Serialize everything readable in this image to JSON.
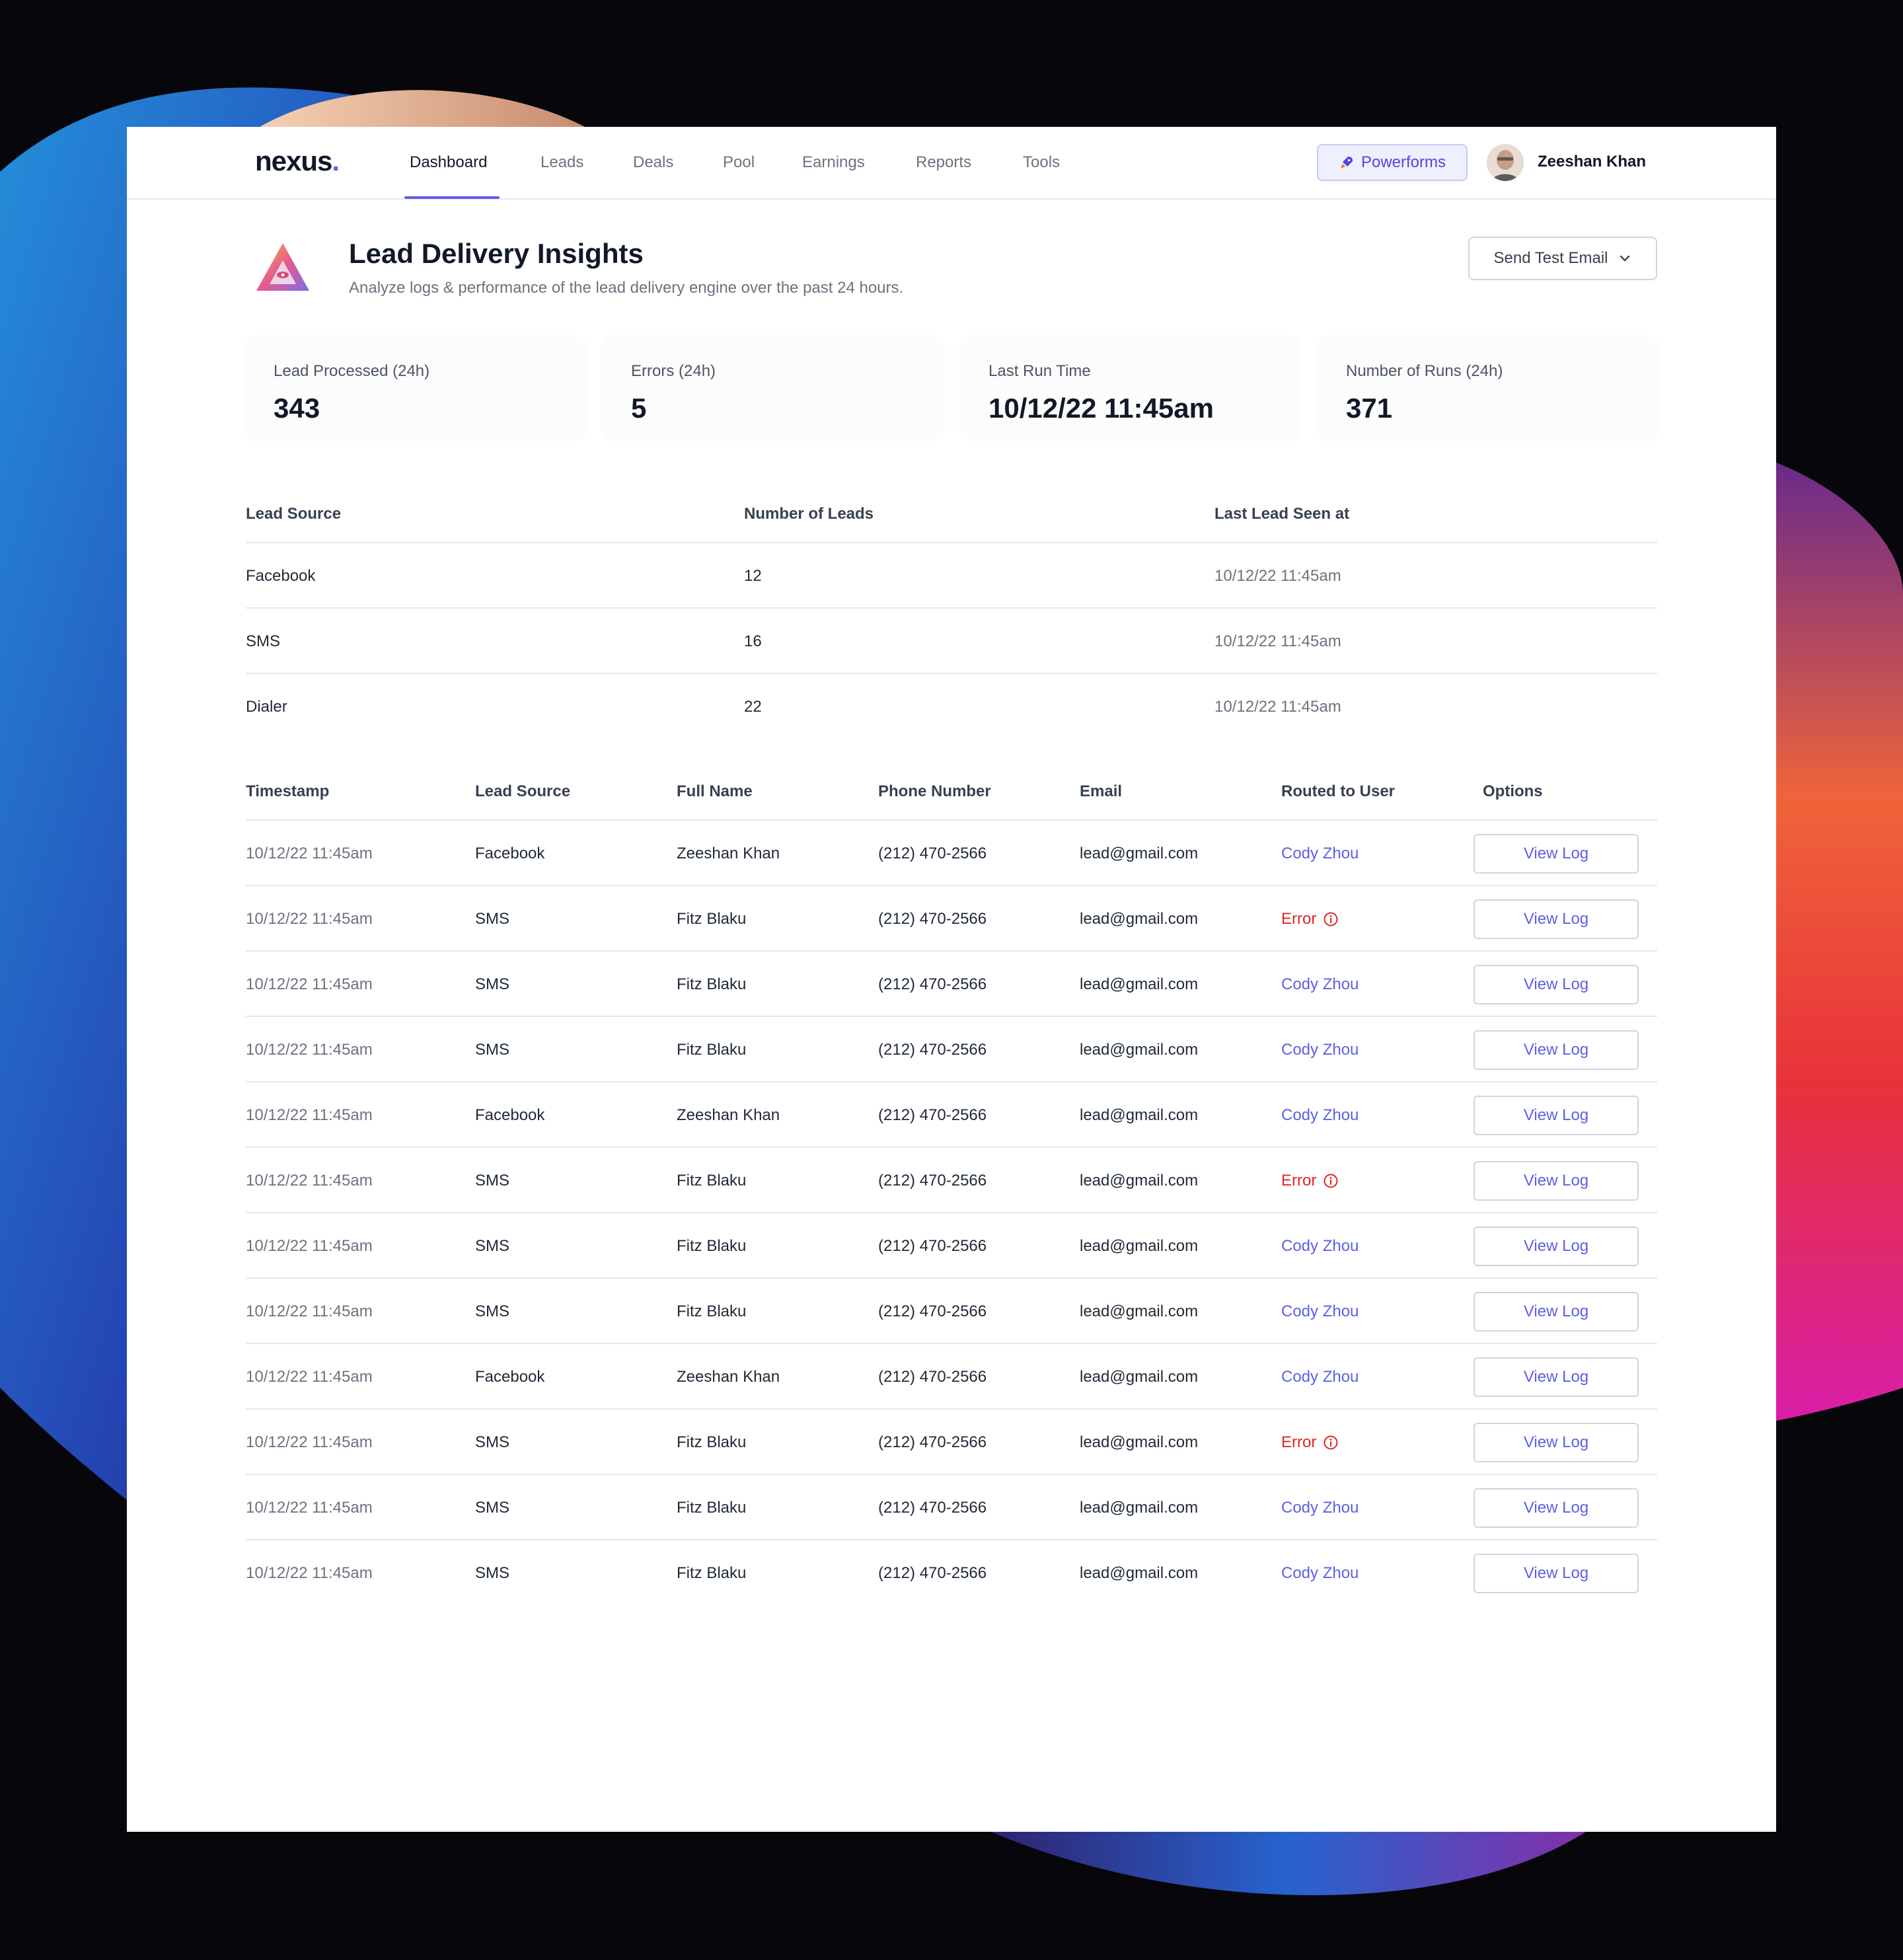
{
  "nav": {
    "logo": "nexus",
    "logo_dot": ".",
    "items": [
      {
        "label": "Dashboard",
        "active": true
      },
      {
        "label": "Leads"
      },
      {
        "label": "Deals"
      },
      {
        "label": "Pool"
      },
      {
        "label": "Earnings"
      },
      {
        "label": "Reports"
      },
      {
        "label": "Tools"
      }
    ],
    "powerforms_label": "Powerforms",
    "powerforms_icon": "rocket-icon",
    "user_name": "Zeeshan Khan"
  },
  "header": {
    "title": "Lead Delivery Insights",
    "subtitle": "Analyze logs & performance of the lead delivery engine over the past 24 hours.",
    "send_test_email": "Send Test Email"
  },
  "stats": [
    {
      "label": "Lead Processed (24h)",
      "value": "343"
    },
    {
      "label": "Errors (24h)",
      "value": "5"
    },
    {
      "label": "Last Run Time",
      "value": "10/12/22 11:45am"
    },
    {
      "label": "Number of Runs (24h)",
      "value": "371"
    }
  ],
  "sources_table": {
    "headers": [
      "Lead Source",
      "Number of Leads",
      "Last Lead Seen at"
    ],
    "rows": [
      [
        "Facebook",
        "12",
        "10/12/22 11:45am"
      ],
      [
        "SMS",
        "16",
        "10/12/22 11:45am"
      ],
      [
        "Dialer",
        "22",
        "10/12/22 11:45am"
      ]
    ]
  },
  "log_table": {
    "headers": [
      "Timestamp",
      "Lead Source",
      "Full Name",
      "Phone Number",
      "Email",
      "Routed to User",
      "Options"
    ],
    "action_label": "View Log",
    "rows": [
      {
        "timestamp": "10/12/22 11:45am",
        "source": "Facebook",
        "name": "Zeeshan Khan",
        "phone": "(212) 470-2566",
        "email": "lead@gmail.com",
        "routed": "Cody Zhou",
        "status": "ok"
      },
      {
        "timestamp": "10/12/22 11:45am",
        "source": "SMS",
        "name": "Fitz Blaku",
        "phone": "(212) 470-2566",
        "email": "lead@gmail.com",
        "routed": "Error",
        "status": "error"
      },
      {
        "timestamp": "10/12/22 11:45am",
        "source": "SMS",
        "name": "Fitz Blaku",
        "phone": "(212) 470-2566",
        "email": "lead@gmail.com",
        "routed": "Cody Zhou",
        "status": "ok"
      },
      {
        "timestamp": "10/12/22 11:45am",
        "source": "SMS",
        "name": "Fitz Blaku",
        "phone": "(212) 470-2566",
        "email": "lead@gmail.com",
        "routed": "Cody Zhou",
        "status": "ok"
      },
      {
        "timestamp": "10/12/22 11:45am",
        "source": "Facebook",
        "name": "Zeeshan Khan",
        "phone": "(212) 470-2566",
        "email": "lead@gmail.com",
        "routed": "Cody Zhou",
        "status": "ok"
      },
      {
        "timestamp": "10/12/22 11:45am",
        "source": "SMS",
        "name": "Fitz Blaku",
        "phone": "(212) 470-2566",
        "email": "lead@gmail.com",
        "routed": "Error",
        "status": "error"
      },
      {
        "timestamp": "10/12/22 11:45am",
        "source": "SMS",
        "name": "Fitz Blaku",
        "phone": "(212) 470-2566",
        "email": "lead@gmail.com",
        "routed": "Cody Zhou",
        "status": "ok"
      },
      {
        "timestamp": "10/12/22 11:45am",
        "source": "SMS",
        "name": "Fitz Blaku",
        "phone": "(212) 470-2566",
        "email": "lead@gmail.com",
        "routed": "Cody Zhou",
        "status": "ok"
      },
      {
        "timestamp": "10/12/22 11:45am",
        "source": "Facebook",
        "name": "Zeeshan Khan",
        "phone": "(212) 470-2566",
        "email": "lead@gmail.com",
        "routed": "Cody Zhou",
        "status": "ok"
      },
      {
        "timestamp": "10/12/22 11:45am",
        "source": "SMS",
        "name": "Fitz Blaku",
        "phone": "(212) 470-2566",
        "email": "lead@gmail.com",
        "routed": "Error",
        "status": "error"
      },
      {
        "timestamp": "10/12/22 11:45am",
        "source": "SMS",
        "name": "Fitz Blaku",
        "phone": "(212) 470-2566",
        "email": "lead@gmail.com",
        "routed": "Cody Zhou",
        "status": "ok"
      },
      {
        "timestamp": "10/12/22 11:45am",
        "source": "SMS",
        "name": "Fitz Blaku",
        "phone": "(212) 470-2566",
        "email": "lead@gmail.com",
        "routed": "Cody Zhou",
        "status": "ok"
      }
    ]
  },
  "colors": {
    "accent": "#5d5fe6",
    "error": "#e02424",
    "background": "#06060b"
  }
}
